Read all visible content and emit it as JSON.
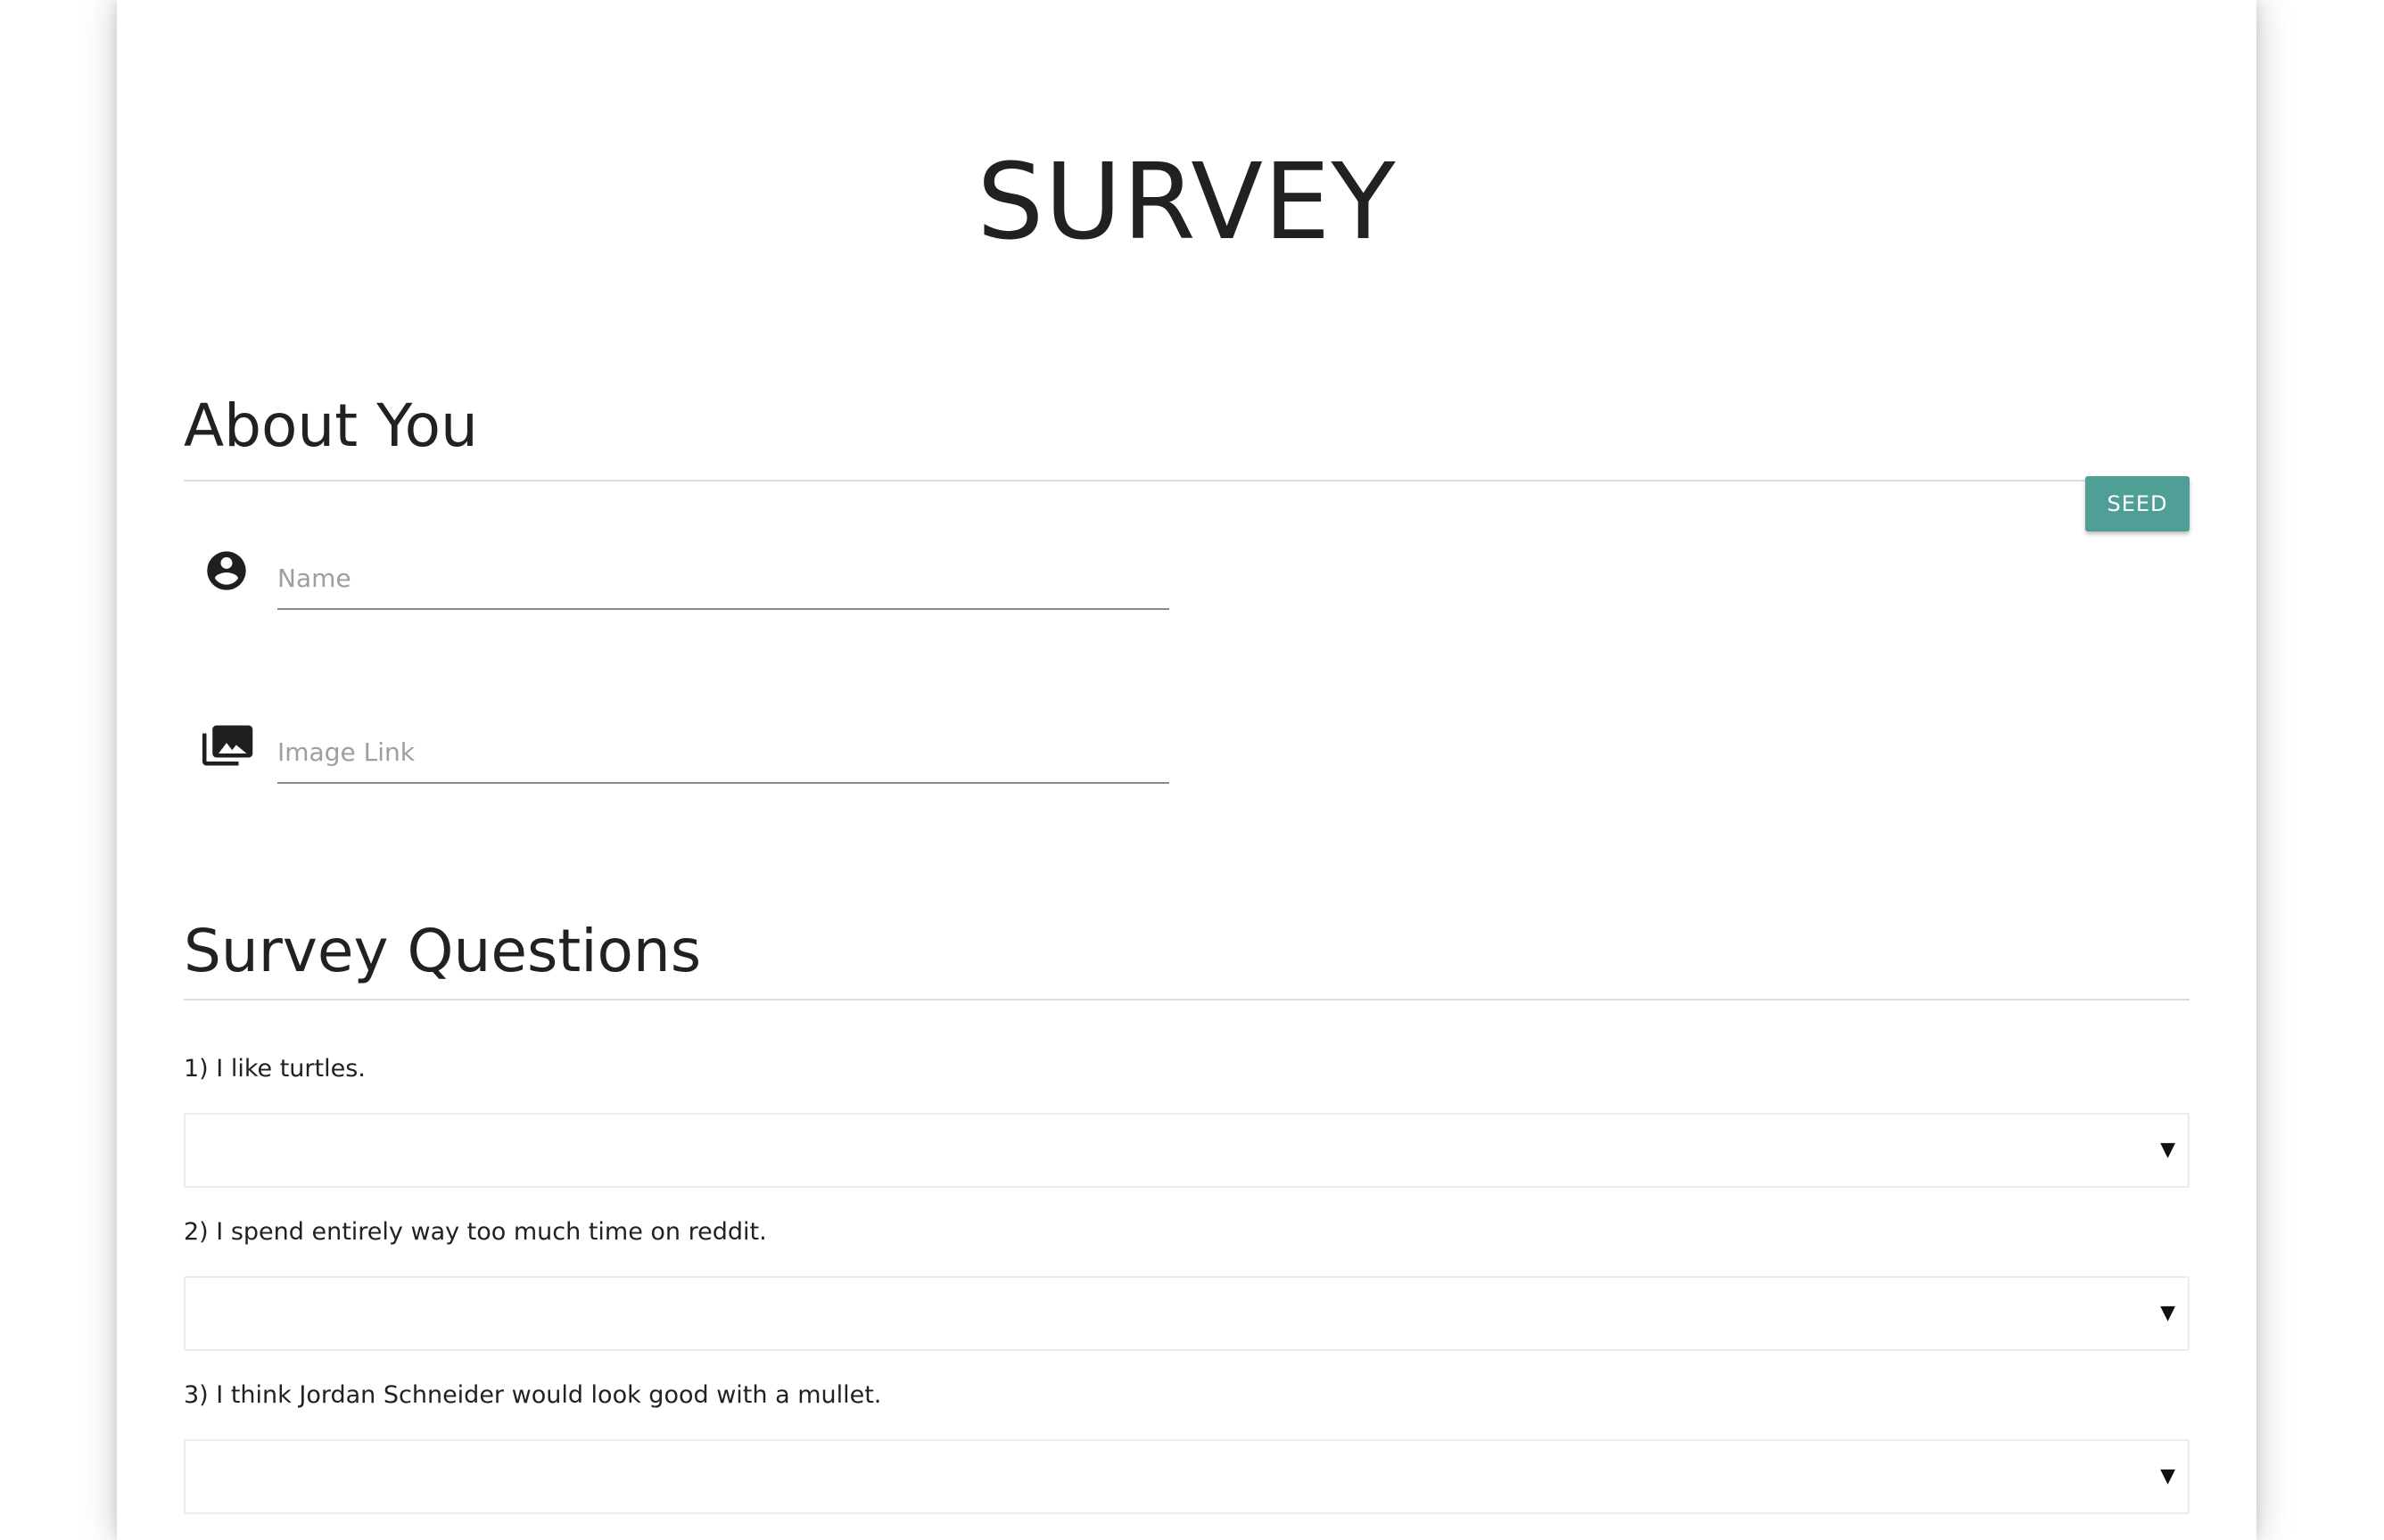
{
  "page": {
    "title": "SURVEY"
  },
  "about": {
    "heading": "About You",
    "seed_label": "SEED",
    "name_field": {
      "placeholder": "Name",
      "value": ""
    },
    "image_field": {
      "placeholder": "Image Link",
      "value": ""
    },
    "icons": {
      "name": "account-circle-icon",
      "image": "photo-library-icon"
    }
  },
  "questions": {
    "heading": "Survey Questions",
    "items": [
      {
        "label": "1) I like turtles.",
        "selected": ""
      },
      {
        "label": "2) I spend entirely way too much time on reddit.",
        "selected": ""
      },
      {
        "label": "3) I think Jordan Schneider would look good with a mullet.",
        "selected": ""
      }
    ],
    "caret": "▼"
  },
  "colors": {
    "seed_button": "#4f9f96",
    "text": "#212121",
    "placeholder": "#9e9e9e"
  }
}
